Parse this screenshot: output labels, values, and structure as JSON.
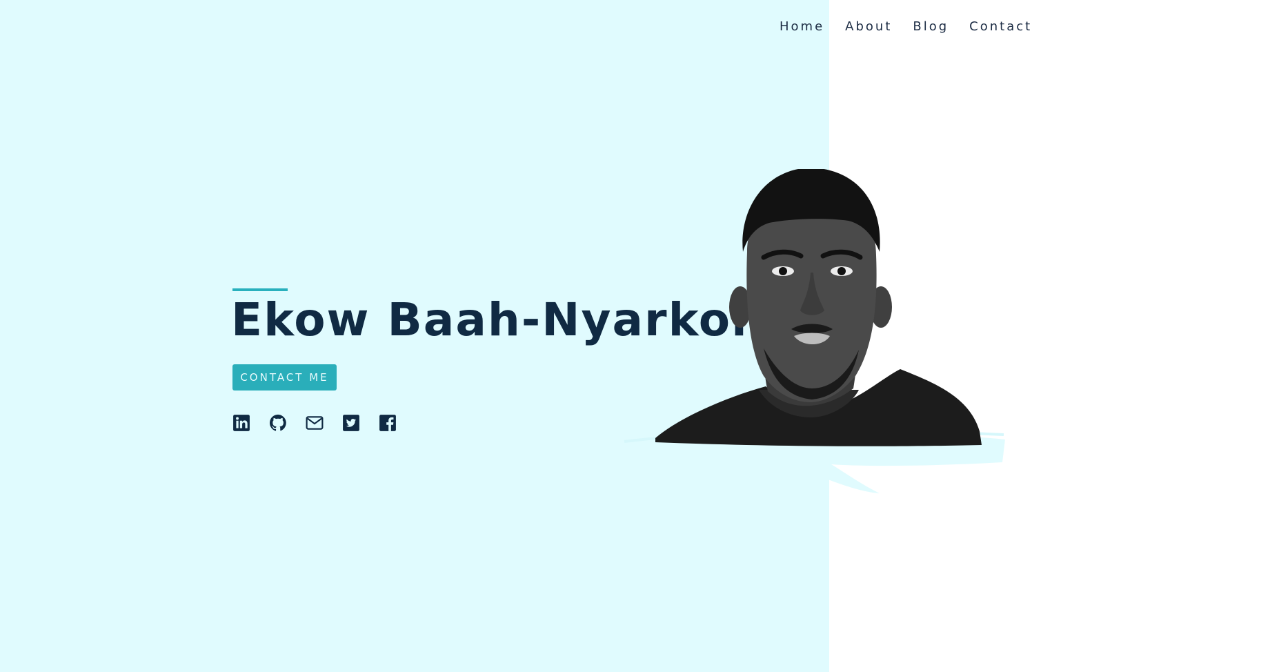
{
  "nav": {
    "items": [
      {
        "label": "Home"
      },
      {
        "label": "About"
      },
      {
        "label": "Blog"
      },
      {
        "label": "Contact"
      }
    ]
  },
  "hero": {
    "name": "Ekow Baah-Nyarkoh",
    "cta_label": "CONTACT ME"
  },
  "social": {
    "icons": [
      "linkedin-icon",
      "github-icon",
      "email-icon",
      "twitter-icon",
      "facebook-icon"
    ]
  },
  "colors": {
    "left_background": "#e0fbfe",
    "right_background": "#ffffff",
    "heading": "#102a43",
    "accent": "#29b0bd",
    "icon": "#102a43"
  }
}
